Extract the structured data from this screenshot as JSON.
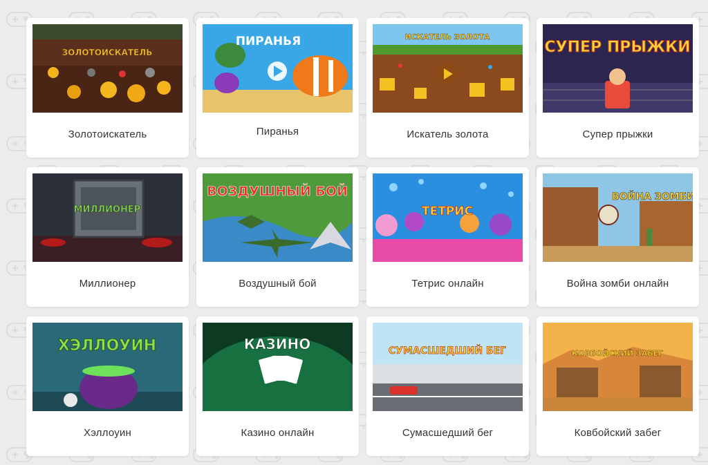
{
  "colors": {
    "page_bg": "#ececec",
    "card_bg": "#ffffff",
    "title_text": "#333333"
  },
  "games": [
    {
      "title": "Золотоискатель",
      "art_text": "ЗОЛОТОИСКАТЕЛЬ",
      "icon": "gold-miner-thumbnail"
    },
    {
      "title": "Пиранья",
      "art_text": "ПИРАНЬЯ",
      "icon": "piranha-thumbnail"
    },
    {
      "title": "Искатель золота",
      "art_text": "ИСКАТЕЛЬ ЗОЛОТА",
      "icon": "gold-seeker-thumbnail"
    },
    {
      "title": "Супер прыжки",
      "art_text": "СУПЕР ПРЫЖКИ",
      "icon": "super-jumps-thumbnail"
    },
    {
      "title": "Миллионер",
      "art_text": "МИЛЛИОНЕР",
      "icon": "millionaire-thumbnail"
    },
    {
      "title": "Воздушный бой",
      "art_text": "ВОЗДУШНЫЙ БОЙ",
      "icon": "air-battle-thumbnail"
    },
    {
      "title": "Тетрис онлайн",
      "art_text": "ТЕТРИС",
      "icon": "tetris-thumbnail"
    },
    {
      "title": "Война зомби онлайн",
      "art_text": "ВОЙНА ЗОМБИ",
      "icon": "zombie-war-thumbnail"
    },
    {
      "title": "Хэллоуин",
      "art_text": "ХЭЛЛОУИН",
      "icon": "halloween-thumbnail"
    },
    {
      "title": "Казино онлайн",
      "art_text": "КАЗИНО",
      "icon": "casino-thumbnail"
    },
    {
      "title": "Сумасшедший бег",
      "art_text": "СУМАСШЕДШИЙ БЕГ",
      "icon": "crazy-run-thumbnail"
    },
    {
      "title": "Ковбойский забег",
      "art_text": "КОВБОЙСКИЙ ЗАБЕГ",
      "icon": "cowboy-run-thumbnail"
    }
  ]
}
